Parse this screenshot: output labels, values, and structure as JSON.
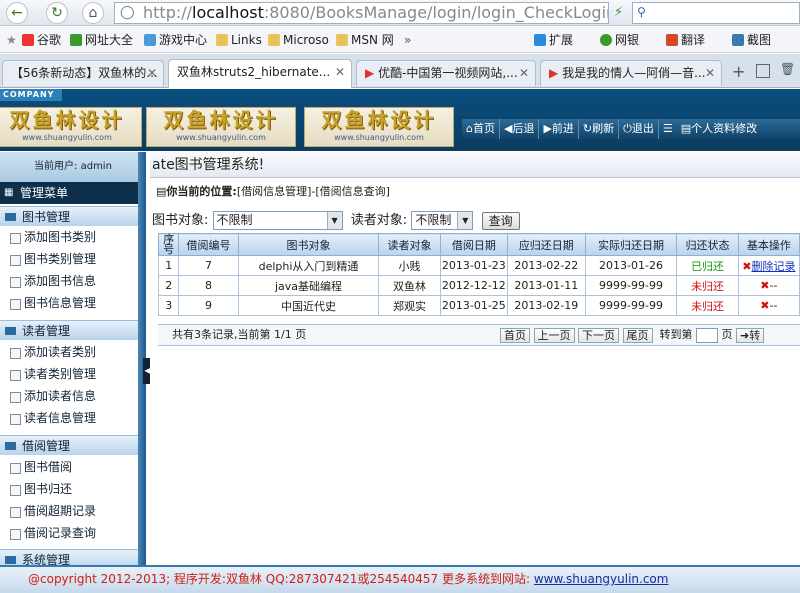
{
  "browser": {
    "url_host": "localhost",
    "url_rest": ":8080/BooksManage/login/login_CheckLogin.acti",
    "bookmarks": [
      "扩展",
      "网银",
      "翻译",
      "截图"
    ],
    "bookmarks_left": [
      "谷歌",
      "网址大全",
      "游戏中心",
      "Links",
      "Microso",
      "MSN 网"
    ],
    "tabs": [
      "【56条新动态】双鱼林的...",
      "双鱼林struts2_hibernate...",
      "优酷-中国第一视频网站,...",
      "我是我的情人—阿俏—音..."
    ]
  },
  "banner": {
    "company": "COMPANY",
    "logo_text": "双鱼林设计",
    "logo_url": "www.shuangyulin.com",
    "nav": [
      "首页",
      "后退",
      "前进",
      "刷新",
      "退出",
      "个人资料修改"
    ]
  },
  "sidebar": {
    "current_user": "当前用户: admin",
    "menu_title": "管理菜单",
    "sections": [
      {
        "title": "图书管理",
        "items": [
          "添加图书类别",
          "图书类别管理",
          "添加图书信息",
          "图书信息管理"
        ]
      },
      {
        "title": "读者管理",
        "items": [
          "添加读者类别",
          "读者类别管理",
          "添加读者信息",
          "读者信息管理"
        ]
      },
      {
        "title": "借阅管理",
        "items": [
          "图书借阅",
          "图书归还",
          "借阅超期记录",
          "借阅记录查询"
        ]
      },
      {
        "title": "系统管理",
        "items": []
      }
    ]
  },
  "main": {
    "system_title": "ate图书管理系统!",
    "location_label": "你当前的位置:",
    "location_path": "[借阅信息管理]-[借阅信息查询]",
    "filter_book_label": "图书对象:",
    "filter_book_value": "不限制",
    "filter_reader_label": "读者对象:",
    "filter_reader_value": "不限制",
    "query_button": "查询",
    "headers": [
      "序号",
      "借阅编号",
      "图书对象",
      "读者对象",
      "借阅日期",
      "应归还日期",
      "实际归还日期",
      "归还状态",
      "基本操作"
    ],
    "rows": [
      {
        "no": "1",
        "id": "7",
        "book": "delphi从入门到精通",
        "reader": "小贱",
        "borrow": "2013-01-23",
        "due": "2013-02-22",
        "returned": "2013-01-26",
        "status": "已归还",
        "status_color": "#119a11",
        "action": "删除记录"
      },
      {
        "no": "2",
        "id": "8",
        "book": "java基础编程",
        "reader": "双鱼林",
        "borrow": "2012-12-12",
        "due": "2013-01-11",
        "returned": "9999-99-99",
        "status": "未归还",
        "status_color": "#d01010",
        "action": "--"
      },
      {
        "no": "3",
        "id": "9",
        "book": "中国近代史",
        "reader": "郑观实",
        "borrow": "2013-01-25",
        "due": "2013-02-19",
        "returned": "9999-99-99",
        "status": "未归还",
        "status_color": "#d01010",
        "action": "--"
      }
    ],
    "pager": {
      "summary": "共有3条记录,当前第 1/1 页",
      "first": "首页",
      "prev": "上一页",
      "next": "下一页",
      "last": "尾页",
      "goto_label": "转到第",
      "page_unit": "页",
      "go": "转"
    }
  },
  "footer": {
    "text": "@copyright 2012-2013; 程序开发:双鱼林 QQ:287307421或254540457 更多系统到网站:",
    "site": "www.shuangyulin.com"
  }
}
